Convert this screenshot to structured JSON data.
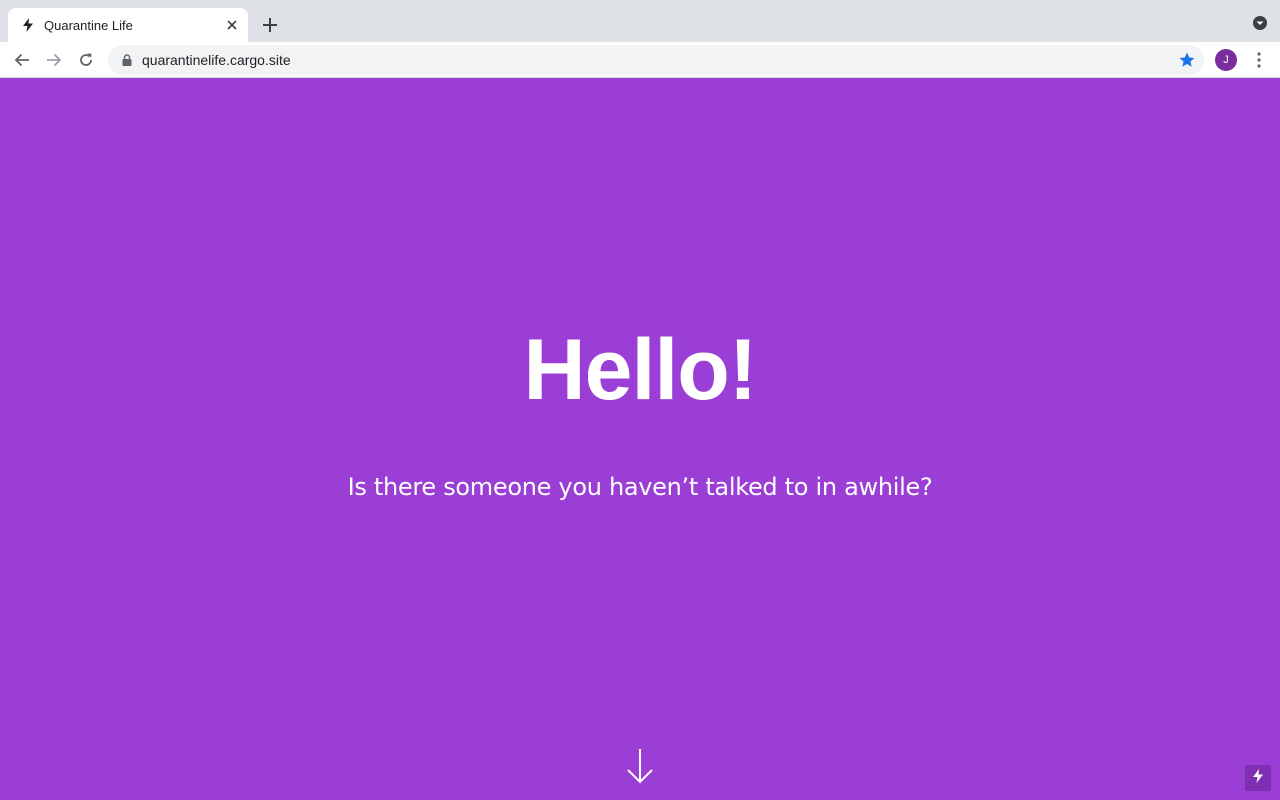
{
  "browser": {
    "tab": {
      "title": "Quarantine Life"
    },
    "omnibox": {
      "url": "quarantinelife.cargo.site"
    },
    "profile": {
      "initial": "J",
      "color": "#7b2d9e"
    }
  },
  "page": {
    "background": "#9b3ed6",
    "headline": "Hello!",
    "subheading": "Is there someone you haven’t talked to in awhile?"
  },
  "icons": {
    "tab_favicon": "lightning-bolt-icon",
    "scroll_indicator": "arrow-down-icon",
    "badge": "lightning-bolt-icon"
  }
}
